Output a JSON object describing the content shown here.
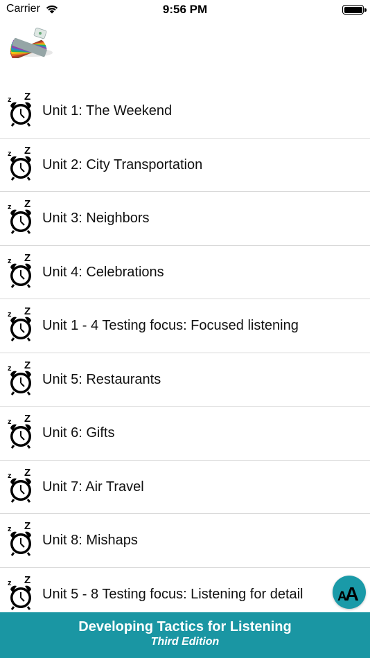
{
  "status_bar": {
    "carrier": "Carrier",
    "time": "9:56 PM"
  },
  "app": {
    "logo_icon": "color-swatch-fan-icon"
  },
  "units": [
    {
      "label": "Unit 1: The Weekend"
    },
    {
      "label": "Unit 2: City Transportation"
    },
    {
      "label": "Unit 3: Neighbors"
    },
    {
      "label": "Unit 4: Celebrations"
    },
    {
      "label": "Unit 1 - 4 Testing focus: Focused listening"
    },
    {
      "label": "Unit 5: Restaurants"
    },
    {
      "label": "Unit 6: Gifts"
    },
    {
      "label": "Unit 7: Air Travel"
    },
    {
      "label": "Unit 8: Mishaps"
    },
    {
      "label": "Unit 5 - 8 Testing focus: Listening for detail"
    }
  ],
  "font_size_button": {
    "icon": "font-size-icon",
    "glyph": "AA"
  },
  "footer": {
    "title": "Developing Tactics for Listening",
    "subtitle": "Third Edition"
  },
  "colors": {
    "accent": "#1a96a3",
    "divider": "#d9d9d9"
  }
}
